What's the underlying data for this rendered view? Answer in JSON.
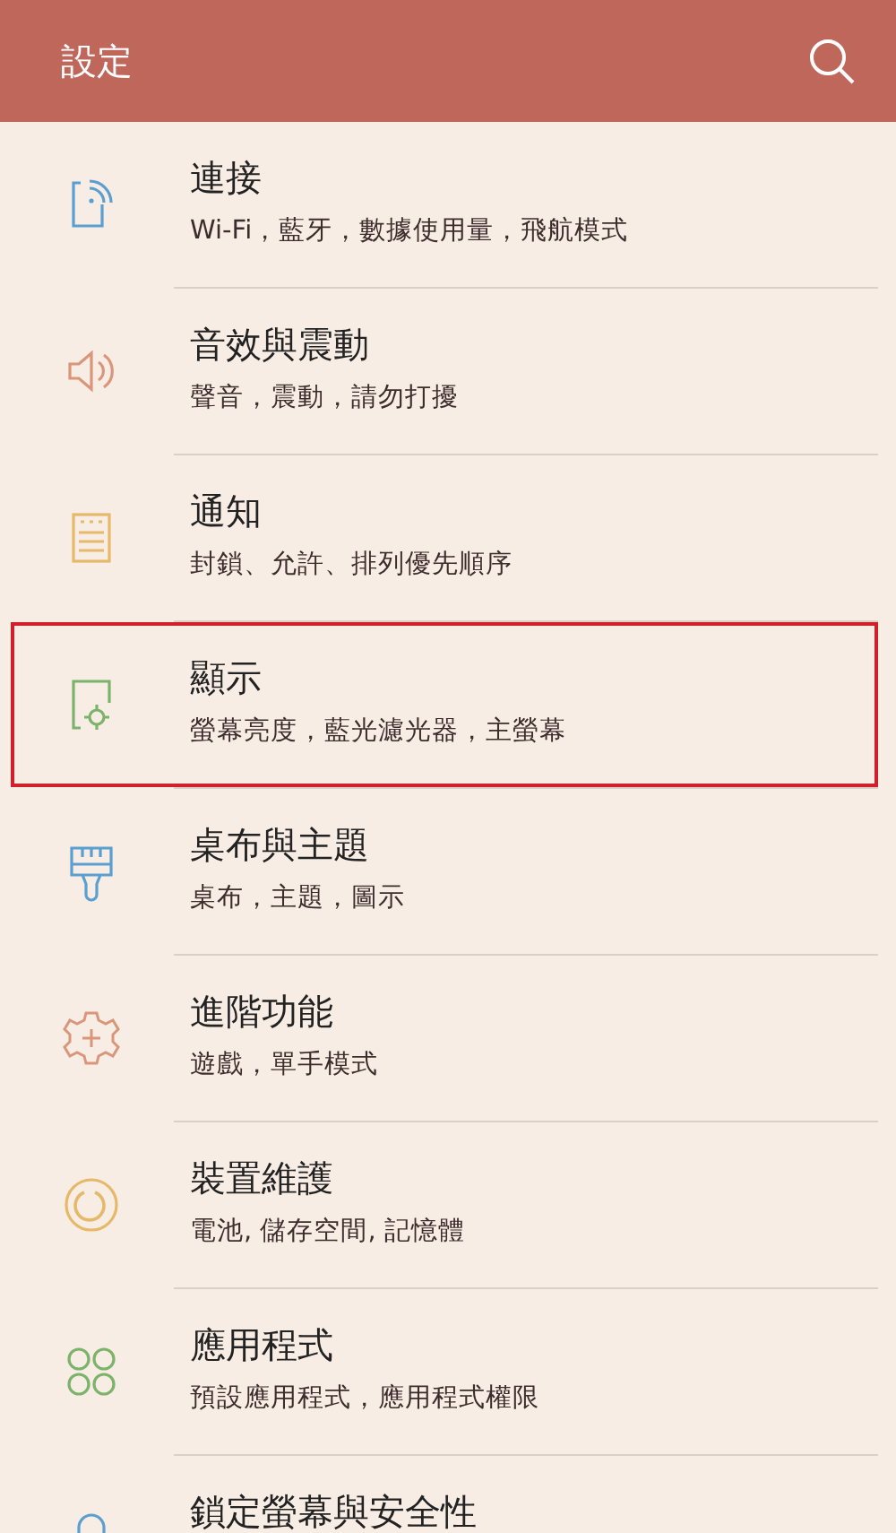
{
  "header": {
    "title": "設定"
  },
  "items": [
    {
      "kind": "connection",
      "color": "#5a9fd0",
      "title": "連接",
      "subtitle": "Wi-Fi，藍牙，數據使用量，飛航模式",
      "highlighted": false
    },
    {
      "kind": "sound",
      "color": "#d9967a",
      "title": "音效與震動",
      "subtitle": "聲音，震動，請勿打擾",
      "highlighted": false
    },
    {
      "kind": "notification",
      "color": "#e6b96a",
      "title": "通知",
      "subtitle": "封鎖、允許、排列優先順序",
      "highlighted": false
    },
    {
      "kind": "display",
      "color": "#7cb36a",
      "title": "顯示",
      "subtitle": "螢幕亮度，藍光濾光器，主螢幕",
      "highlighted": true
    },
    {
      "kind": "wallpaper",
      "color": "#5a9fd0",
      "title": "桌布與主題",
      "subtitle": "桌布，主題，圖示",
      "highlighted": false
    },
    {
      "kind": "advanced",
      "color": "#d9967a",
      "title": "進階功能",
      "subtitle": "遊戲，單手模式",
      "highlighted": false
    },
    {
      "kind": "maintenance",
      "color": "#e6b96a",
      "title": "裝置維護",
      "subtitle": "電池, 儲存空間, 記憶體",
      "highlighted": false
    },
    {
      "kind": "apps",
      "color": "#7cb36a",
      "title": "應用程式",
      "subtitle": "預設應用程式，應用程式權限",
      "highlighted": false
    },
    {
      "kind": "lock",
      "color": "#5a9fd0",
      "title": "鎖定螢幕與安全性",
      "highlighted": false
    }
  ]
}
